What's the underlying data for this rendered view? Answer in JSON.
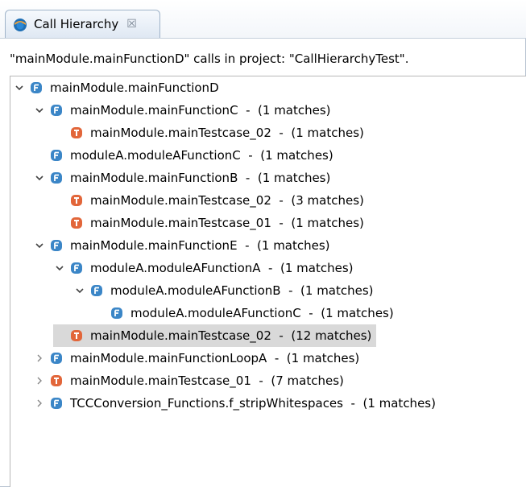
{
  "tab": {
    "title": "Call Hierarchy",
    "close_glyph": "☒"
  },
  "header": {
    "text": "\"mainModule.mainFunctionD\" calls in project: \"CallHierarchyTest\"."
  },
  "colors": {
    "function_icon": "#3b86c7",
    "testcase_icon": "#e2663a",
    "selection": "#d9d9d9"
  },
  "tree": {
    "nodes": [
      {
        "label": "mainModule.mainFunctionD",
        "kind": "function",
        "depth": 0,
        "twisty": "expanded"
      },
      {
        "label": "mainModule.mainFunctionC  -  (1 matches)",
        "kind": "function",
        "depth": 1,
        "twisty": "expanded"
      },
      {
        "label": "mainModule.mainTestcase_02  -  (1 matches)",
        "kind": "testcase",
        "depth": 2,
        "twisty": "none"
      },
      {
        "label": "moduleA.moduleAFunctionC  -  (1 matches)",
        "kind": "function",
        "depth": 1,
        "twisty": "none"
      },
      {
        "label": "mainModule.mainFunctionB  -  (1 matches)",
        "kind": "function",
        "depth": 1,
        "twisty": "expanded"
      },
      {
        "label": "mainModule.mainTestcase_02  -  (3 matches)",
        "kind": "testcase",
        "depth": 2,
        "twisty": "none"
      },
      {
        "label": "mainModule.mainTestcase_01  -  (1 matches)",
        "kind": "testcase",
        "depth": 2,
        "twisty": "none"
      },
      {
        "label": "mainModule.mainFunctionE  -  (1 matches)",
        "kind": "function",
        "depth": 1,
        "twisty": "expanded"
      },
      {
        "label": "moduleA.moduleAFunctionA  -  (1 matches)",
        "kind": "function",
        "depth": 2,
        "twisty": "expanded"
      },
      {
        "label": "moduleA.moduleAFunctionB  -  (1 matches)",
        "kind": "function",
        "depth": 3,
        "twisty": "expanded"
      },
      {
        "label": "moduleA.moduleAFunctionC  -  (1 matches)",
        "kind": "function",
        "depth": 4,
        "twisty": "none"
      },
      {
        "label": "mainModule.mainTestcase_02  -  (12 matches)",
        "kind": "testcase",
        "depth": 2,
        "twisty": "none",
        "selected": true
      },
      {
        "label": "mainModule.mainFunctionLoopA  -  (1 matches)",
        "kind": "function",
        "depth": 1,
        "twisty": "collapsed"
      },
      {
        "label": "mainModule.mainTestcase_01  -  (7 matches)",
        "kind": "testcase",
        "depth": 1,
        "twisty": "collapsed"
      },
      {
        "label": "TCCConversion_Functions.f_stripWhitespaces  -  (1 matches)",
        "kind": "function",
        "depth": 1,
        "twisty": "collapsed"
      }
    ]
  }
}
